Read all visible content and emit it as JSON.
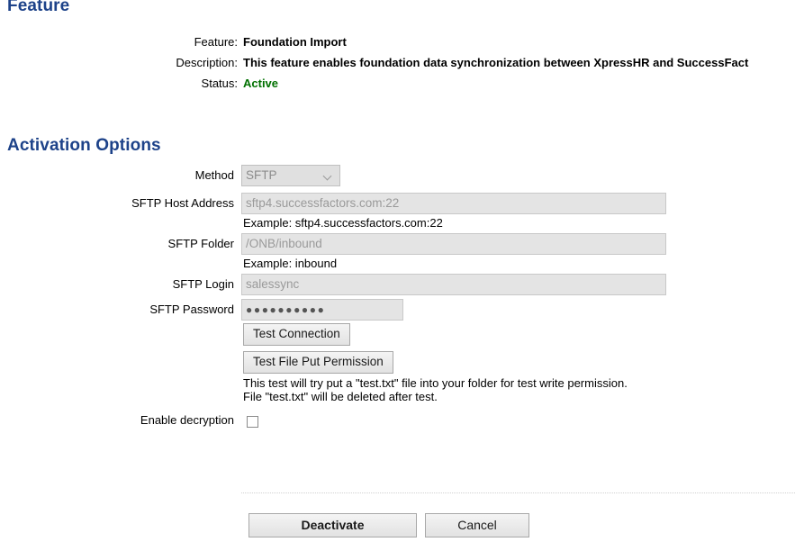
{
  "page": {
    "heading": "Feature",
    "activation_heading": "Activation Options"
  },
  "summary": {
    "rows": [
      {
        "label": "Feature:",
        "value": "Foundation Import"
      },
      {
        "label": "Description:",
        "value": "This feature enables foundation data synchronization between XpressHR and SuccessFact"
      },
      {
        "label": "Status:",
        "value": "Active"
      }
    ]
  },
  "form": {
    "method": {
      "label": "Method",
      "value": "SFTP",
      "options": [
        "SFTP"
      ]
    },
    "host": {
      "label": "SFTP Host Address",
      "value": "sftp4.successfactors.com:22",
      "example": "Example: sftp4.successfactors.com:22"
    },
    "folder": {
      "label": "SFTP Folder",
      "value": "/ONB/inbound",
      "example": "Example: inbound"
    },
    "login": {
      "label": "SFTP Login",
      "value": "salessync"
    },
    "password": {
      "label": "SFTP Password",
      "value": "●●●●●●●●●●"
    },
    "test_connection_label": "Test Connection",
    "test_put_label": "Test File Put Permission",
    "test_put_note_line1": "This test will try put a \"test.txt\" file into your folder for test write permission.",
    "test_put_note_line2": "File \"test.txt\" will be deleted after test.",
    "decryption": {
      "label": "Enable decryption",
      "checked": false
    }
  },
  "footer": {
    "deactivate_label": "Deactivate",
    "cancel_label": "Cancel"
  },
  "colors": {
    "heading_blue": "#1d4289",
    "status_green": "#007000"
  }
}
